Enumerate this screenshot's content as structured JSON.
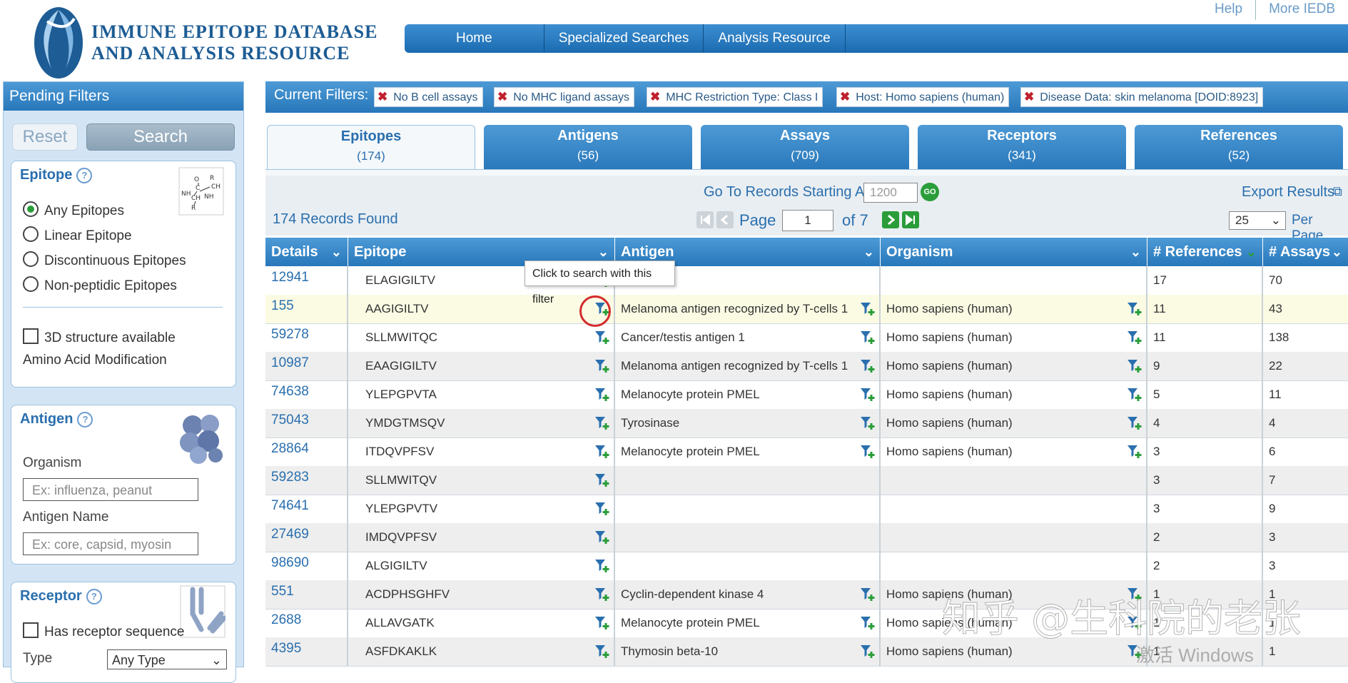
{
  "header": {
    "logo_line1": "IMMUNE EPITOPE DATABASE",
    "logo_line2": "AND ANALYSIS RESOURCE",
    "top_links": [
      "Help",
      "More IEDB"
    ],
    "nav": [
      "Home",
      "Specialized Searches",
      "Analysis Resource"
    ]
  },
  "sidebar": {
    "title": "Pending Filters",
    "reset_label": "Reset",
    "search_label": "Search",
    "epitope": {
      "title": "Epitope",
      "options": [
        "Any Epitopes",
        "Linear Epitope",
        "Discontinuous Epitopes",
        "Non-peptidic Epitopes"
      ],
      "selected": "Any Epitopes",
      "structure_label": "3D structure available",
      "modification_label": "Amino Acid Modification"
    },
    "antigen": {
      "title": "Antigen",
      "organism_label": "Organism",
      "organism_placeholder": "Ex: influenza, peanut",
      "name_label": "Antigen Name",
      "name_placeholder": "Ex: core, capsid, myosin"
    },
    "receptor": {
      "title": "Receptor",
      "has_sequence_label": "Has receptor sequence",
      "type_label": "Type",
      "type_value": "Any Type"
    }
  },
  "filters": {
    "label": "Current Filters:",
    "chips": [
      "No B cell assays",
      "No MHC ligand assays",
      "MHC Restriction Type: Class I",
      "Host: Homo sapiens (human)",
      "Disease Data: skin melanoma [DOID:8923]"
    ]
  },
  "tabs": [
    {
      "label": "Epitopes",
      "count": "(174)"
    },
    {
      "label": "Antigens",
      "count": "(56)"
    },
    {
      "label": "Assays",
      "count": "(709)"
    },
    {
      "label": "Receptors",
      "count": "(341)"
    },
    {
      "label": "References",
      "count": "(52)"
    }
  ],
  "toolbar": {
    "goto_label": "Go To Records Starting At",
    "goto_value": "1200",
    "go_label": "GO",
    "export_label": "Export Results",
    "records_found": "174 Records Found",
    "page_label": "Page",
    "page_value": "1",
    "of_label": "of 7",
    "per_page_value": "25",
    "per_page_label": "Per Page"
  },
  "table": {
    "columns": [
      "Details",
      "Epitope",
      "Antigen",
      "Organism",
      "# References",
      "# Assays"
    ],
    "tooltip": "Click to search with this filter",
    "rows": [
      {
        "id": "12941",
        "epitope": "ELAGIGILTV",
        "antigen": "",
        "organism": "",
        "refs": "17",
        "assays": "70"
      },
      {
        "id": "155",
        "epitope": "AAGIGILTV",
        "antigen": "Melanoma antigen recognized by T-cells 1",
        "organism": "Homo sapiens (human)",
        "refs": "11",
        "assays": "43"
      },
      {
        "id": "59278",
        "epitope": "SLLMWITQC",
        "antigen": "Cancer/testis antigen 1",
        "organism": "Homo sapiens (human)",
        "refs": "11",
        "assays": "138"
      },
      {
        "id": "10987",
        "epitope": "EAAGIGILTV",
        "antigen": "Melanoma antigen recognized by T-cells 1",
        "organism": "Homo sapiens (human)",
        "refs": "9",
        "assays": "22"
      },
      {
        "id": "74638",
        "epitope": "YLEPGPVTA",
        "antigen": "Melanocyte protein PMEL",
        "organism": "Homo sapiens (human)",
        "refs": "5",
        "assays": "11"
      },
      {
        "id": "75043",
        "epitope": "YMDGTMSQV",
        "antigen": "Tyrosinase",
        "organism": "Homo sapiens (human)",
        "refs": "4",
        "assays": "4"
      },
      {
        "id": "28864",
        "epitope": "ITDQVPFSV",
        "antigen": "Melanocyte protein PMEL",
        "organism": "Homo sapiens (human)",
        "refs": "3",
        "assays": "6"
      },
      {
        "id": "59283",
        "epitope": "SLLMWITQV",
        "antigen": "",
        "organism": "",
        "refs": "3",
        "assays": "7"
      },
      {
        "id": "74641",
        "epitope": "YLEPGPVTV",
        "antigen": "",
        "organism": "",
        "refs": "3",
        "assays": "9"
      },
      {
        "id": "27469",
        "epitope": "IMDQVPFSV",
        "antigen": "",
        "organism": "",
        "refs": "2",
        "assays": "3"
      },
      {
        "id": "98690",
        "epitope": "ALGIGILTV",
        "antigen": "",
        "organism": "",
        "refs": "2",
        "assays": "3"
      },
      {
        "id": "551",
        "epitope": "ACDPHSGHFV",
        "antigen": "Cyclin-dependent kinase 4",
        "organism": "Homo sapiens (human)",
        "refs": "1",
        "assays": "1"
      },
      {
        "id": "2688",
        "epitope": "ALLAVGATK",
        "antigen": "Melanocyte protein PMEL",
        "organism": "Homo sapiens (human)",
        "refs": "1",
        "assays": "1"
      },
      {
        "id": "4395",
        "epitope": "ASFDKAKLK",
        "antigen": "Thymosin beta-10",
        "organism": "Homo sapiens (human)",
        "refs": "1",
        "assays": "1"
      }
    ]
  },
  "overlay": {
    "watermark": "知乎 @生科院的老张",
    "activate": "激活 Windows"
  },
  "colors": {
    "brand_blue": "#2777ba",
    "link_blue": "#2a6fae",
    "highlight_row": "#fbfbe4",
    "circle_red": "#d42a2a"
  }
}
